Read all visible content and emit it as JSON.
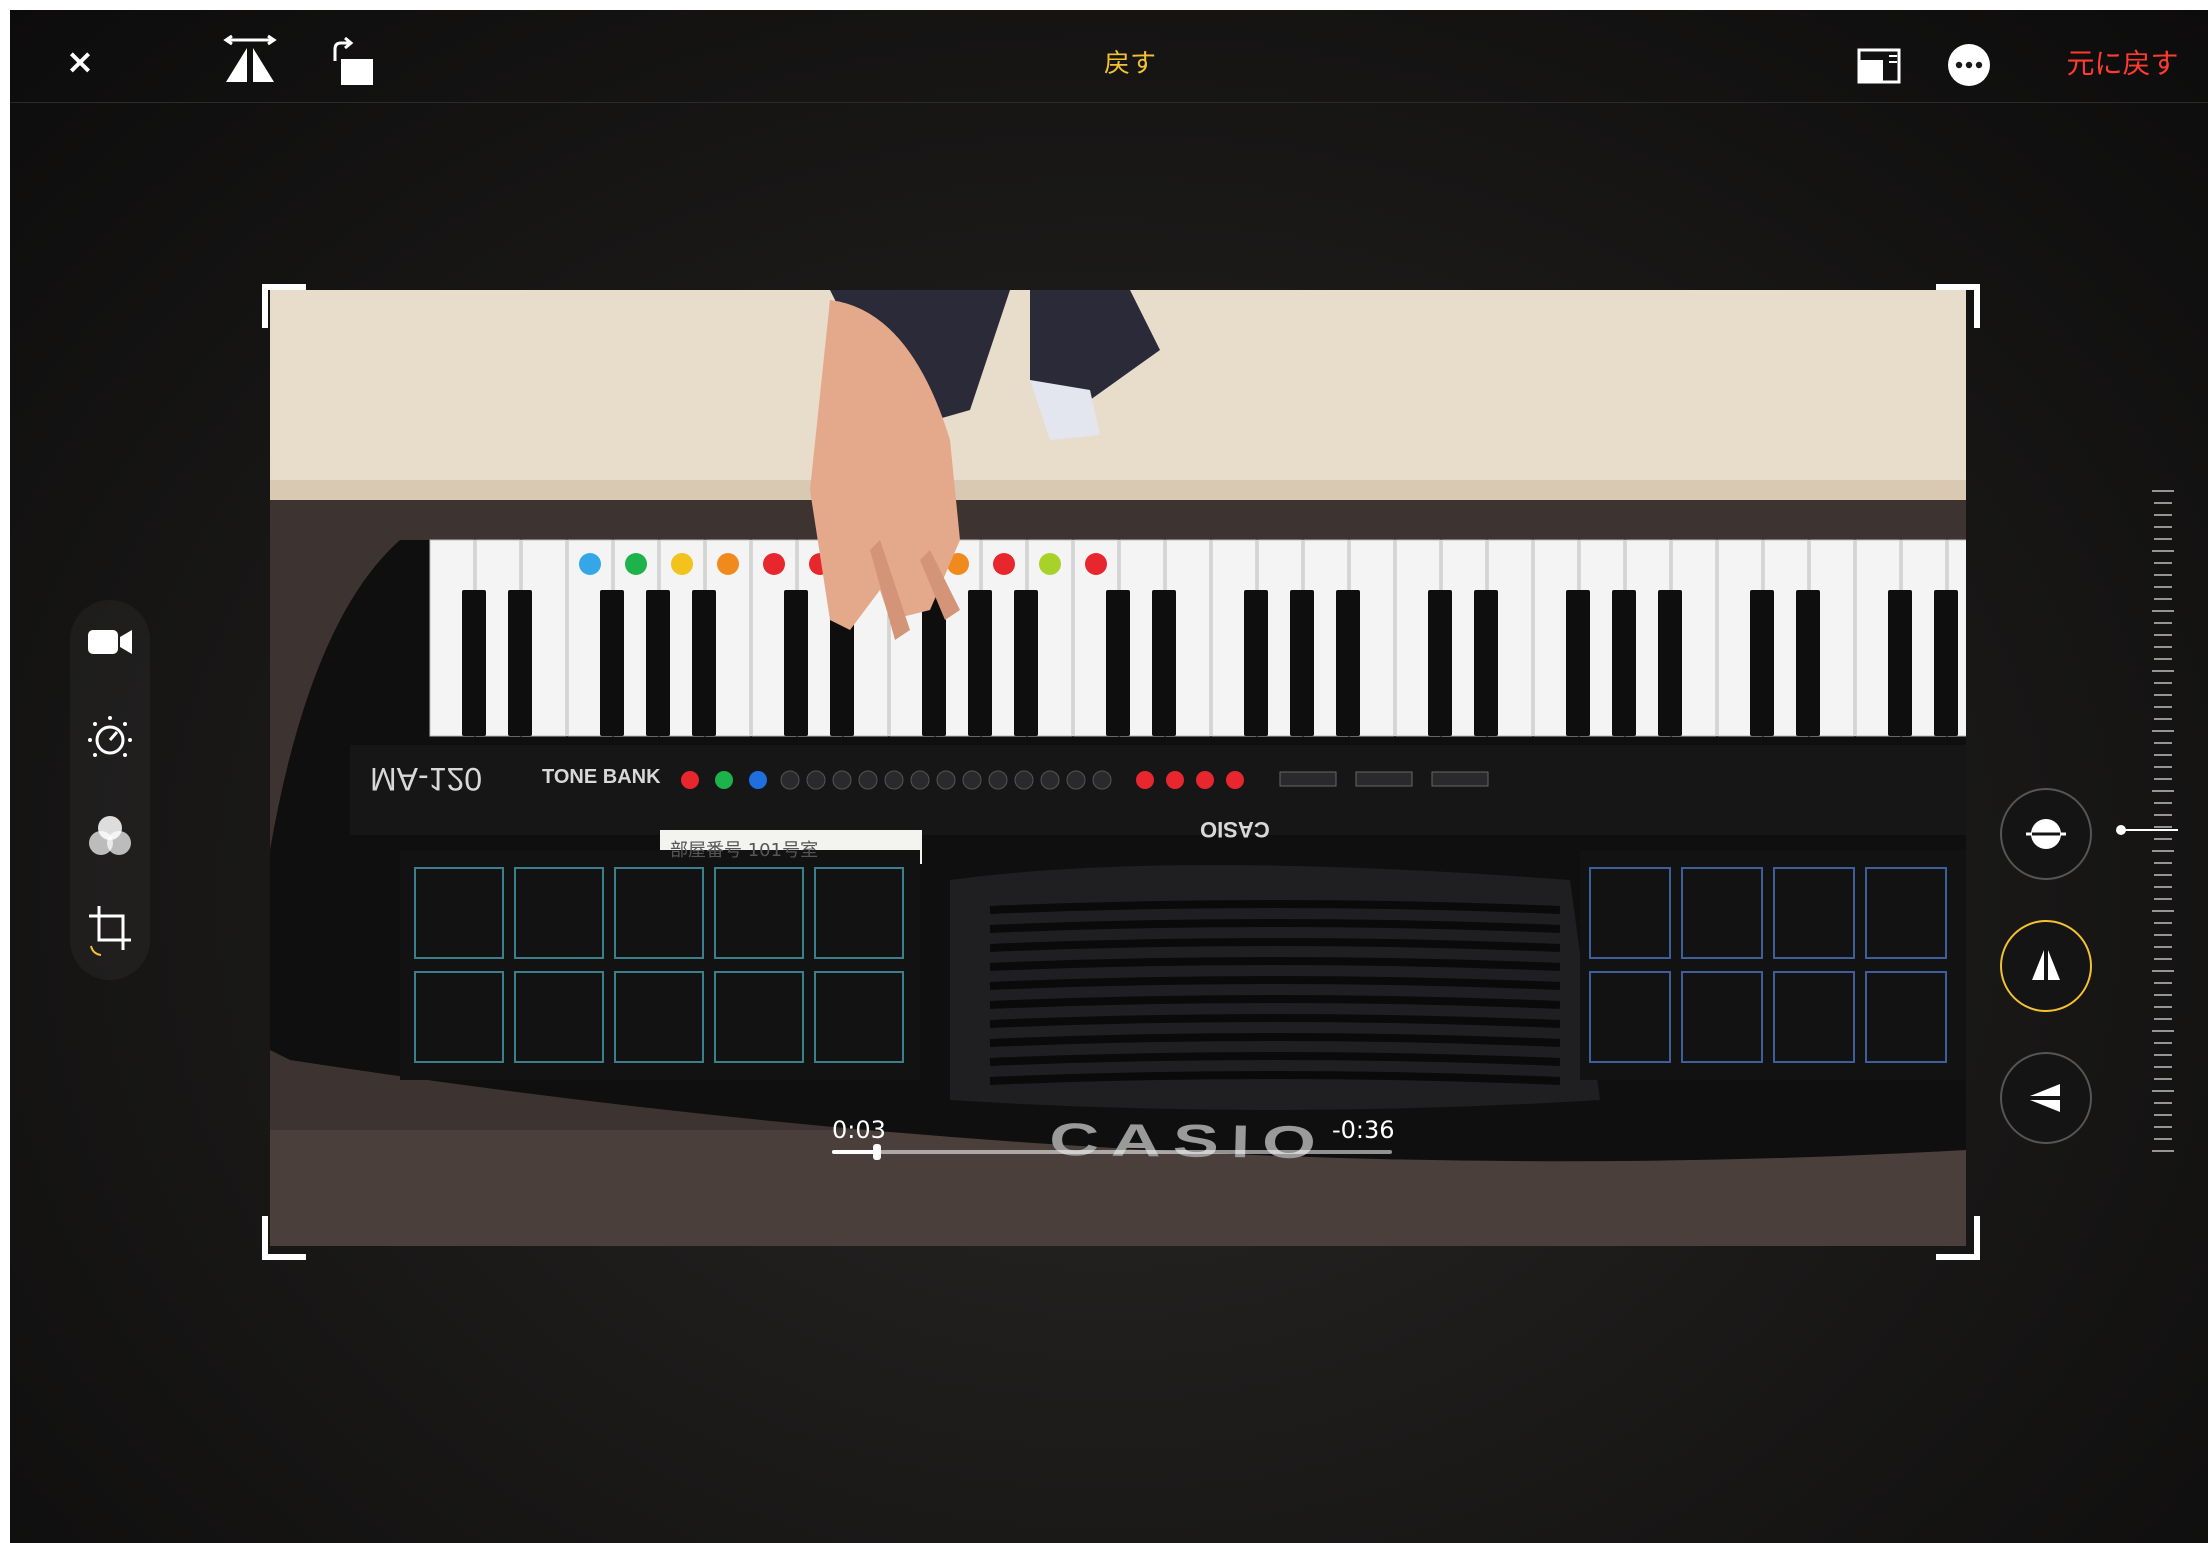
{
  "topbar": {
    "close_label": "×",
    "title": "戻す",
    "revert_label": "元に戻す"
  },
  "icons": {
    "close": "close-icon",
    "flip": "flip-horizontal-icon",
    "rotate": "rotate-icon",
    "aspect": "aspect-ratio-icon",
    "more": "more-icon",
    "video": "video-camera-icon",
    "adjust": "adjust-dial-icon",
    "filters": "filters-icon",
    "crop": "crop-rotate-icon",
    "straighten": "straighten-icon",
    "vertical": "vertical-perspective-icon",
    "horizontal": "horizontal-perspective-icon"
  },
  "colors": {
    "accent_yellow": "#f2c230",
    "revert_red": "#ff3b30",
    "background": "#1a1918"
  },
  "video": {
    "brand_front": "CASIO",
    "brand_panel": "CASIO",
    "model": "MA-120",
    "series": "TONE BANK",
    "label_card": "部屋番号 101号室",
    "elapsed": "0:03",
    "remaining": "-0:36",
    "progress": 0.08,
    "key_stickers": [
      "#35a7e8",
      "#1eb24a",
      "#f4c21c",
      "#f08a1c",
      "#e8262e",
      "#e8262e",
      "#1f6fe0",
      "#f08a1c",
      "#f08a1c",
      "#e8262e",
      "#a8d22a",
      "#e8262e"
    ]
  },
  "straighten": {
    "value_fraction": 0.5
  }
}
